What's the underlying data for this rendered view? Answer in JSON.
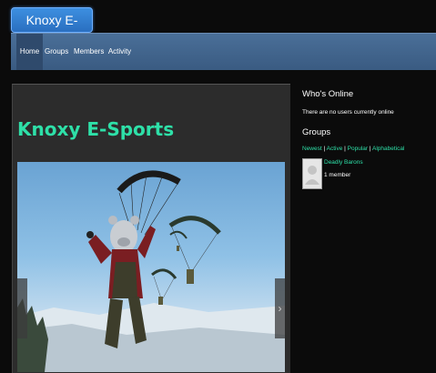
{
  "site": {
    "logo_text": "Knoxy E-Sports"
  },
  "nav": {
    "items": [
      {
        "label": "Home",
        "active": true
      },
      {
        "label": "Groups",
        "active": false
      },
      {
        "label": "Members",
        "active": false
      },
      {
        "label": "Activity",
        "active": false
      }
    ]
  },
  "main": {
    "title": "Knoxy E-Sports",
    "slider": {
      "prev_icon": "chevron-left-icon",
      "next_icon": "chevron-right-icon",
      "next_glyph": "›"
    }
  },
  "sidebar": {
    "whos_online": {
      "title": "Who's Online",
      "text": "There are no users currently online"
    },
    "groups": {
      "title": "Groups",
      "filters": [
        "Newest",
        "Active",
        "Popular",
        "Alphabetical"
      ],
      "items": [
        {
          "name": "Deadly Barons",
          "members": "1 member"
        }
      ]
    }
  },
  "colors": {
    "accent": "#2ee0a8",
    "nav_bg": "#4a6f98",
    "logo_bg": "#3d8fe0",
    "page_bg": "#0b0b0b",
    "panel_bg": "#2c2c2c"
  }
}
